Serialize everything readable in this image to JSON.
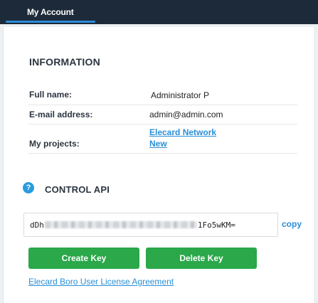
{
  "tabs": [
    {
      "label": "My Account",
      "active": true
    }
  ],
  "information": {
    "title": "INFORMATION",
    "full_name_label": "Full name:",
    "full_name_value": "Administrator  P",
    "email_label": "E-mail address:",
    "email_value": "admin@admin.com",
    "projects_label": "My projects:",
    "projects": [
      "Elecard Network",
      "New"
    ]
  },
  "control_api": {
    "help_icon": "question-circle-icon",
    "help_glyph": "?",
    "title": "CONTROL API",
    "key_prefix": "dDh",
    "key_suffix": "1Fo5wKM=",
    "copy_label": "copy",
    "create_label": "Create Key",
    "delete_label": "Delete Key"
  },
  "license_link": "Elecard Boro User License Agreement",
  "colors": {
    "topbar": "#1c2a39",
    "tab_accent": "#2d8bd8",
    "link": "#2a8fd6",
    "button": "#2aa84a",
    "help_icon": "#2a9be0"
  }
}
